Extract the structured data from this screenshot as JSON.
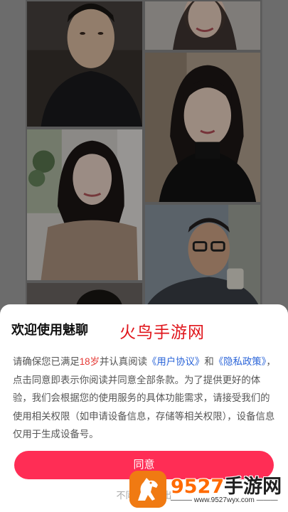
{
  "background": {
    "photos": [
      {
        "name": "man-in-dark-shirt"
      },
      {
        "name": "woman-smiling-top"
      },
      {
        "name": "woman-black-turtleneck"
      },
      {
        "name": "woman-knit-top"
      },
      {
        "name": "man-with-glasses-and-cup"
      },
      {
        "name": "man-partial-bottom"
      }
    ]
  },
  "dialog": {
    "title": "欢迎使用魅聊",
    "watermark": "火鸟手游网",
    "body": {
      "p1": "请确保您已满足",
      "age": "18岁",
      "p2": "并认真阅读",
      "user_agreement": "《用户协议》",
      "and": "和",
      "privacy_policy": "《隐私政策》",
      "p3": "，点击同意即表示你阅读并同意全部条款。为了提供更好的体验，我们会根据您的使用服务的具体功能需求，请接受我们的使用相关权限（如申请设备信息，存储等相关权限），设备信息仅用于生成设备号。"
    },
    "agree_label": "同意",
    "decline_label": "不同意并退出"
  },
  "site_watermark": {
    "number": "9527",
    "name": "手游网",
    "url": "www.9527wyx.com"
  },
  "colors": {
    "accent": "#ff2d55",
    "link": "#2a64d8",
    "age_highlight": "#e53935",
    "watermark_red": "#e0151b",
    "site_orange": "#f07a12"
  }
}
